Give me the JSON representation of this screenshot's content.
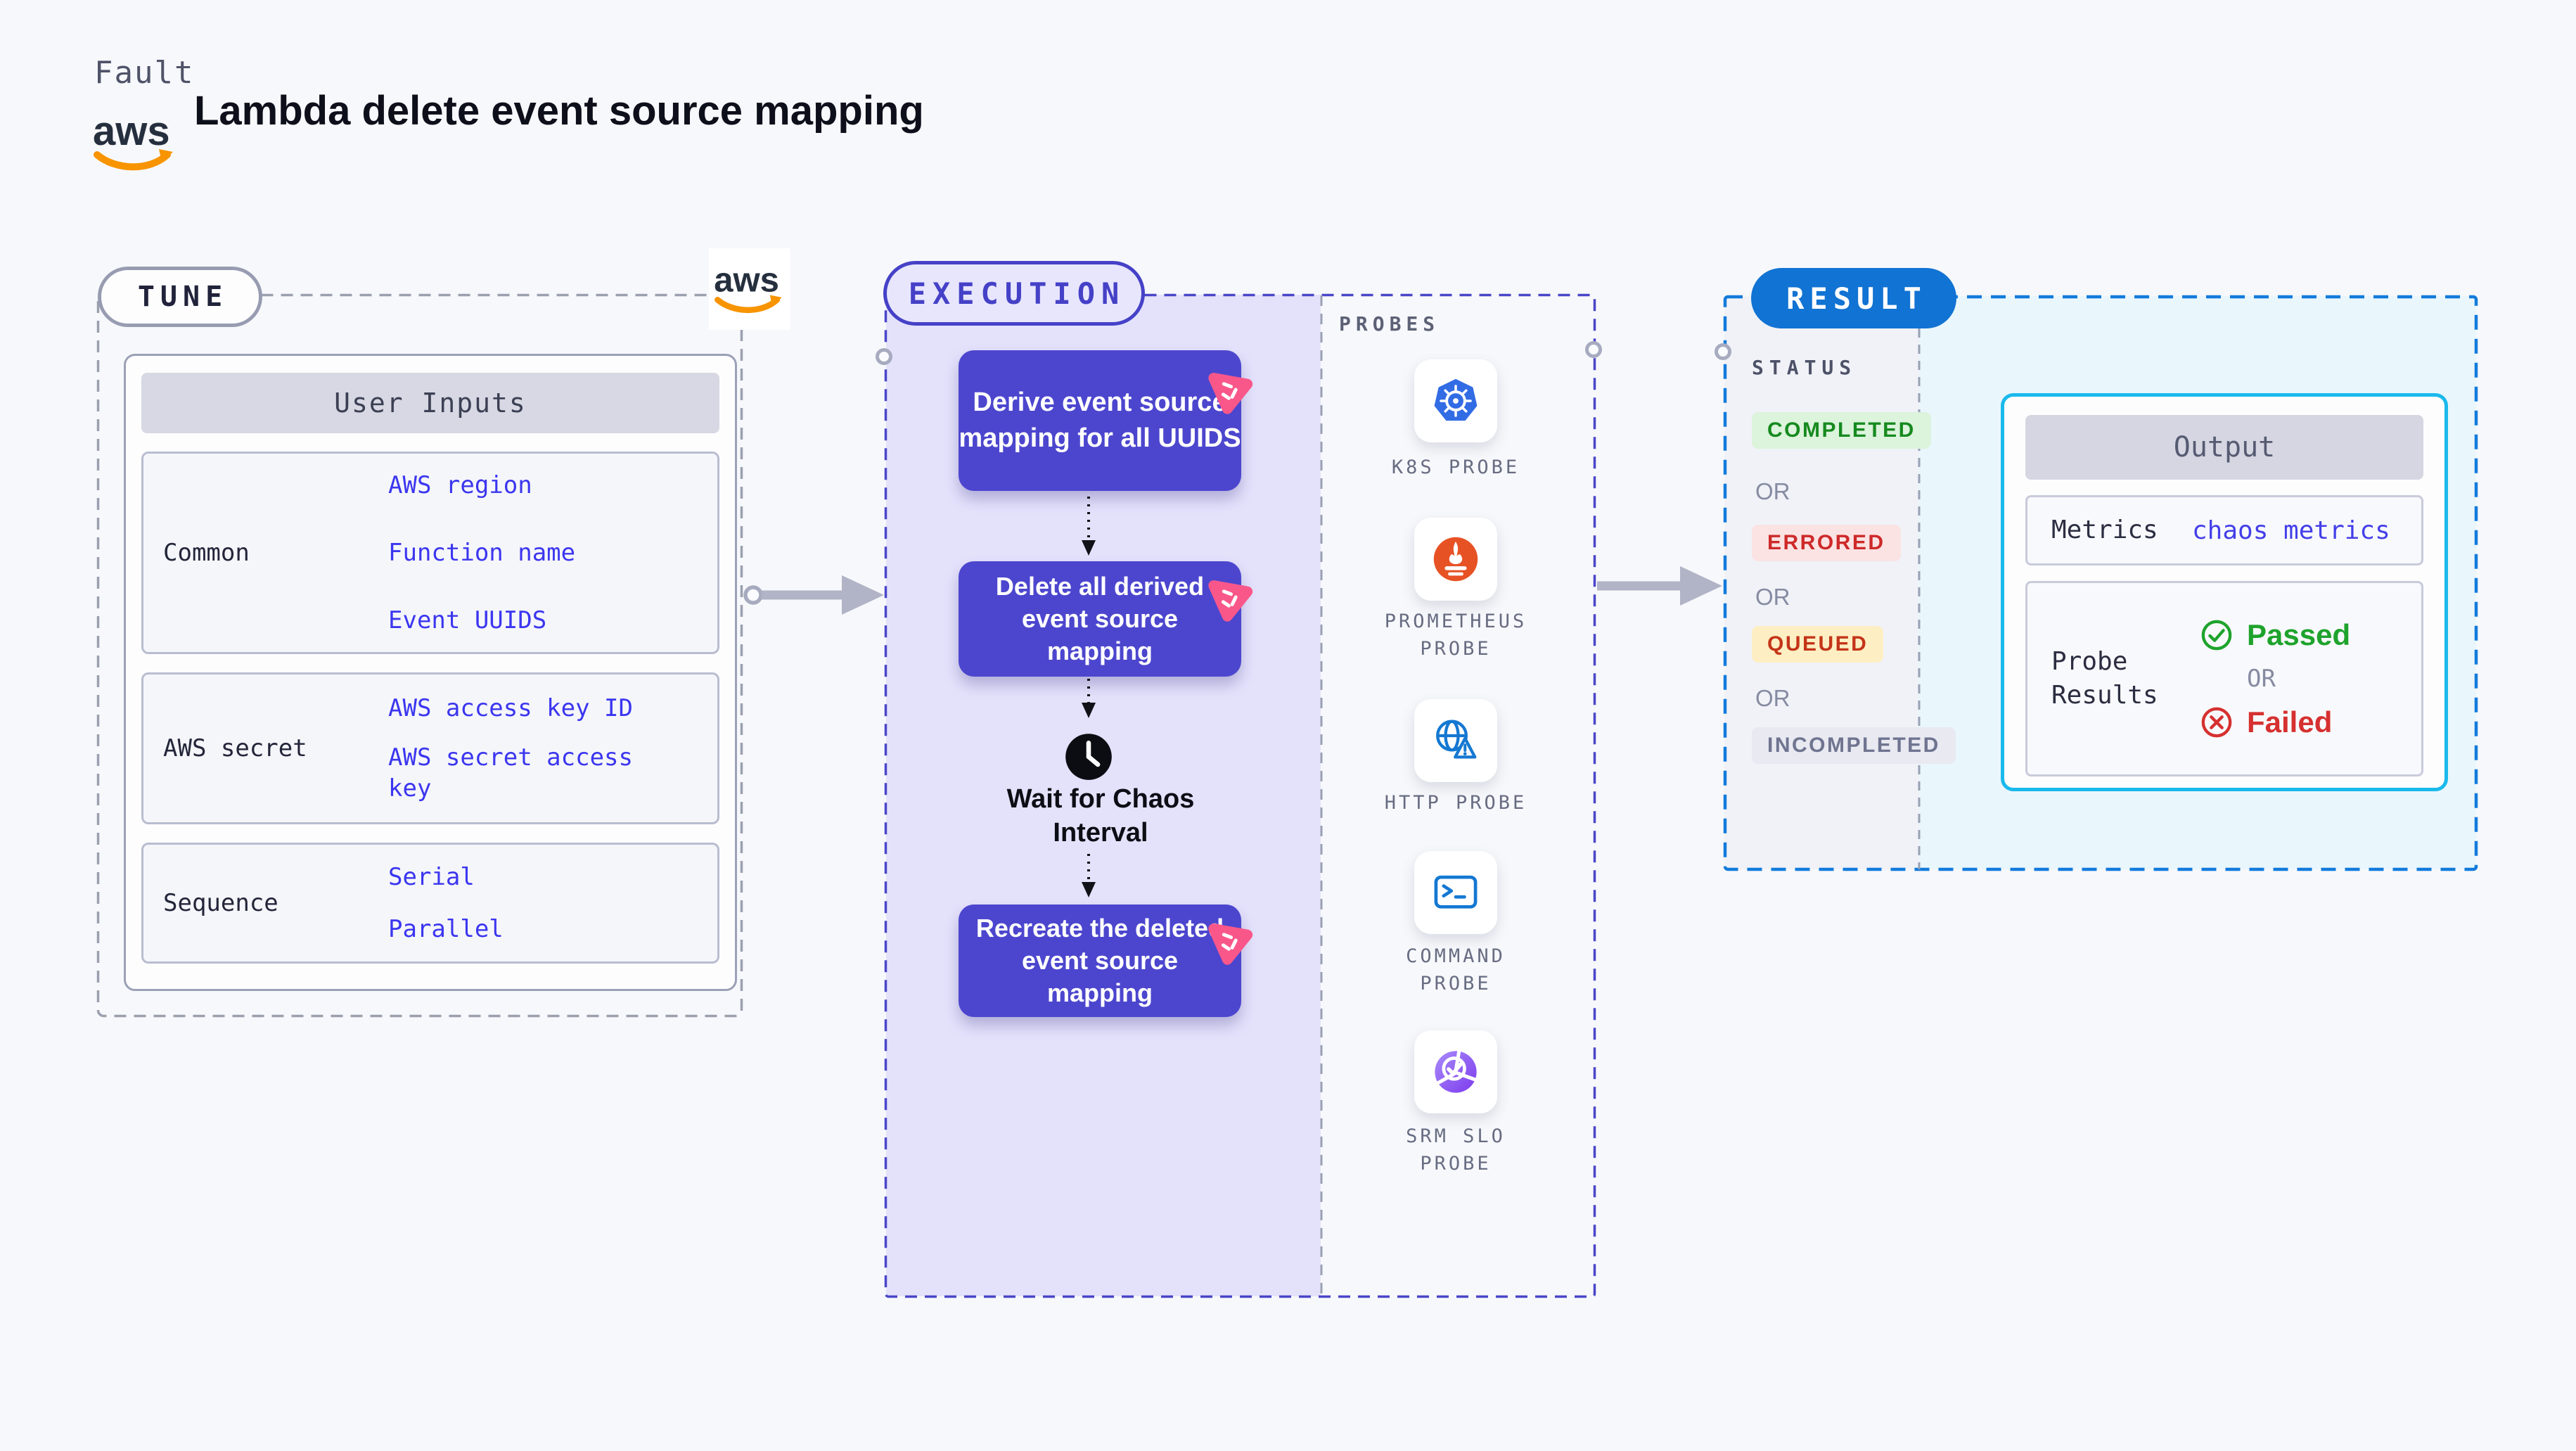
{
  "header": {
    "eyebrow": "Fault",
    "title": "Lambda delete event source mapping",
    "logo_text": "aws"
  },
  "tune": {
    "pill": "TUNE",
    "panel_title": "User Inputs",
    "rows": [
      {
        "label": "Common",
        "links": [
          "AWS region",
          "Function name",
          "Event UUIDS"
        ]
      },
      {
        "label": "AWS secret",
        "links": [
          "AWS access key ID",
          "AWS secret access key"
        ]
      },
      {
        "label": "Sequence",
        "links": [
          "Serial",
          "Parallel"
        ]
      }
    ]
  },
  "execution": {
    "pill": "EXECUTION",
    "step1": "Derive event source\nmapping for all UUIDS",
    "step2": "Delete all derived\nevent source\nmapping",
    "wait_label": "Wait for Chaos\nInterval",
    "step3": "Recreate the deleted\nevent source\nmapping"
  },
  "probes": {
    "title": "PROBES",
    "items": [
      {
        "label": "K8S PROBE",
        "icon": "kubernetes-icon"
      },
      {
        "label": "PROMETHEUS PROBE",
        "icon": "prometheus-icon"
      },
      {
        "label": "HTTP PROBE",
        "icon": "http-globe-warning-icon"
      },
      {
        "label": "COMMAND PROBE",
        "icon": "terminal-icon"
      },
      {
        "label": "SRM SLO PROBE",
        "icon": "srm-slo-gauge-icon"
      }
    ]
  },
  "result": {
    "pill": "RESULT",
    "status_title": "STATUS",
    "or": "OR",
    "statuses": [
      {
        "label": "COMPLETED"
      },
      {
        "label": "ERRORED"
      },
      {
        "label": "QUEUED"
      },
      {
        "label": "INCOMPLETED"
      }
    ],
    "output": {
      "title": "Output",
      "metrics_label": "Metrics",
      "metrics_value": "chaos metrics",
      "probe_results_label": "Probe Results",
      "passed": "Passed",
      "failed": "Failed"
    }
  },
  "colors": {
    "accent_indigo": "#4c46ce",
    "purple_fill": "#e4e2fb",
    "chaos_pink": "#f9578a",
    "result_blue": "#1173d3",
    "cyan_border": "#1ab9ec",
    "link_blue": "#3b36ef",
    "passed_green": "#1ea32c",
    "failed_red": "#d63030",
    "kubernetes_blue": "#326ce5",
    "prometheus_orange": "#e75225"
  }
}
